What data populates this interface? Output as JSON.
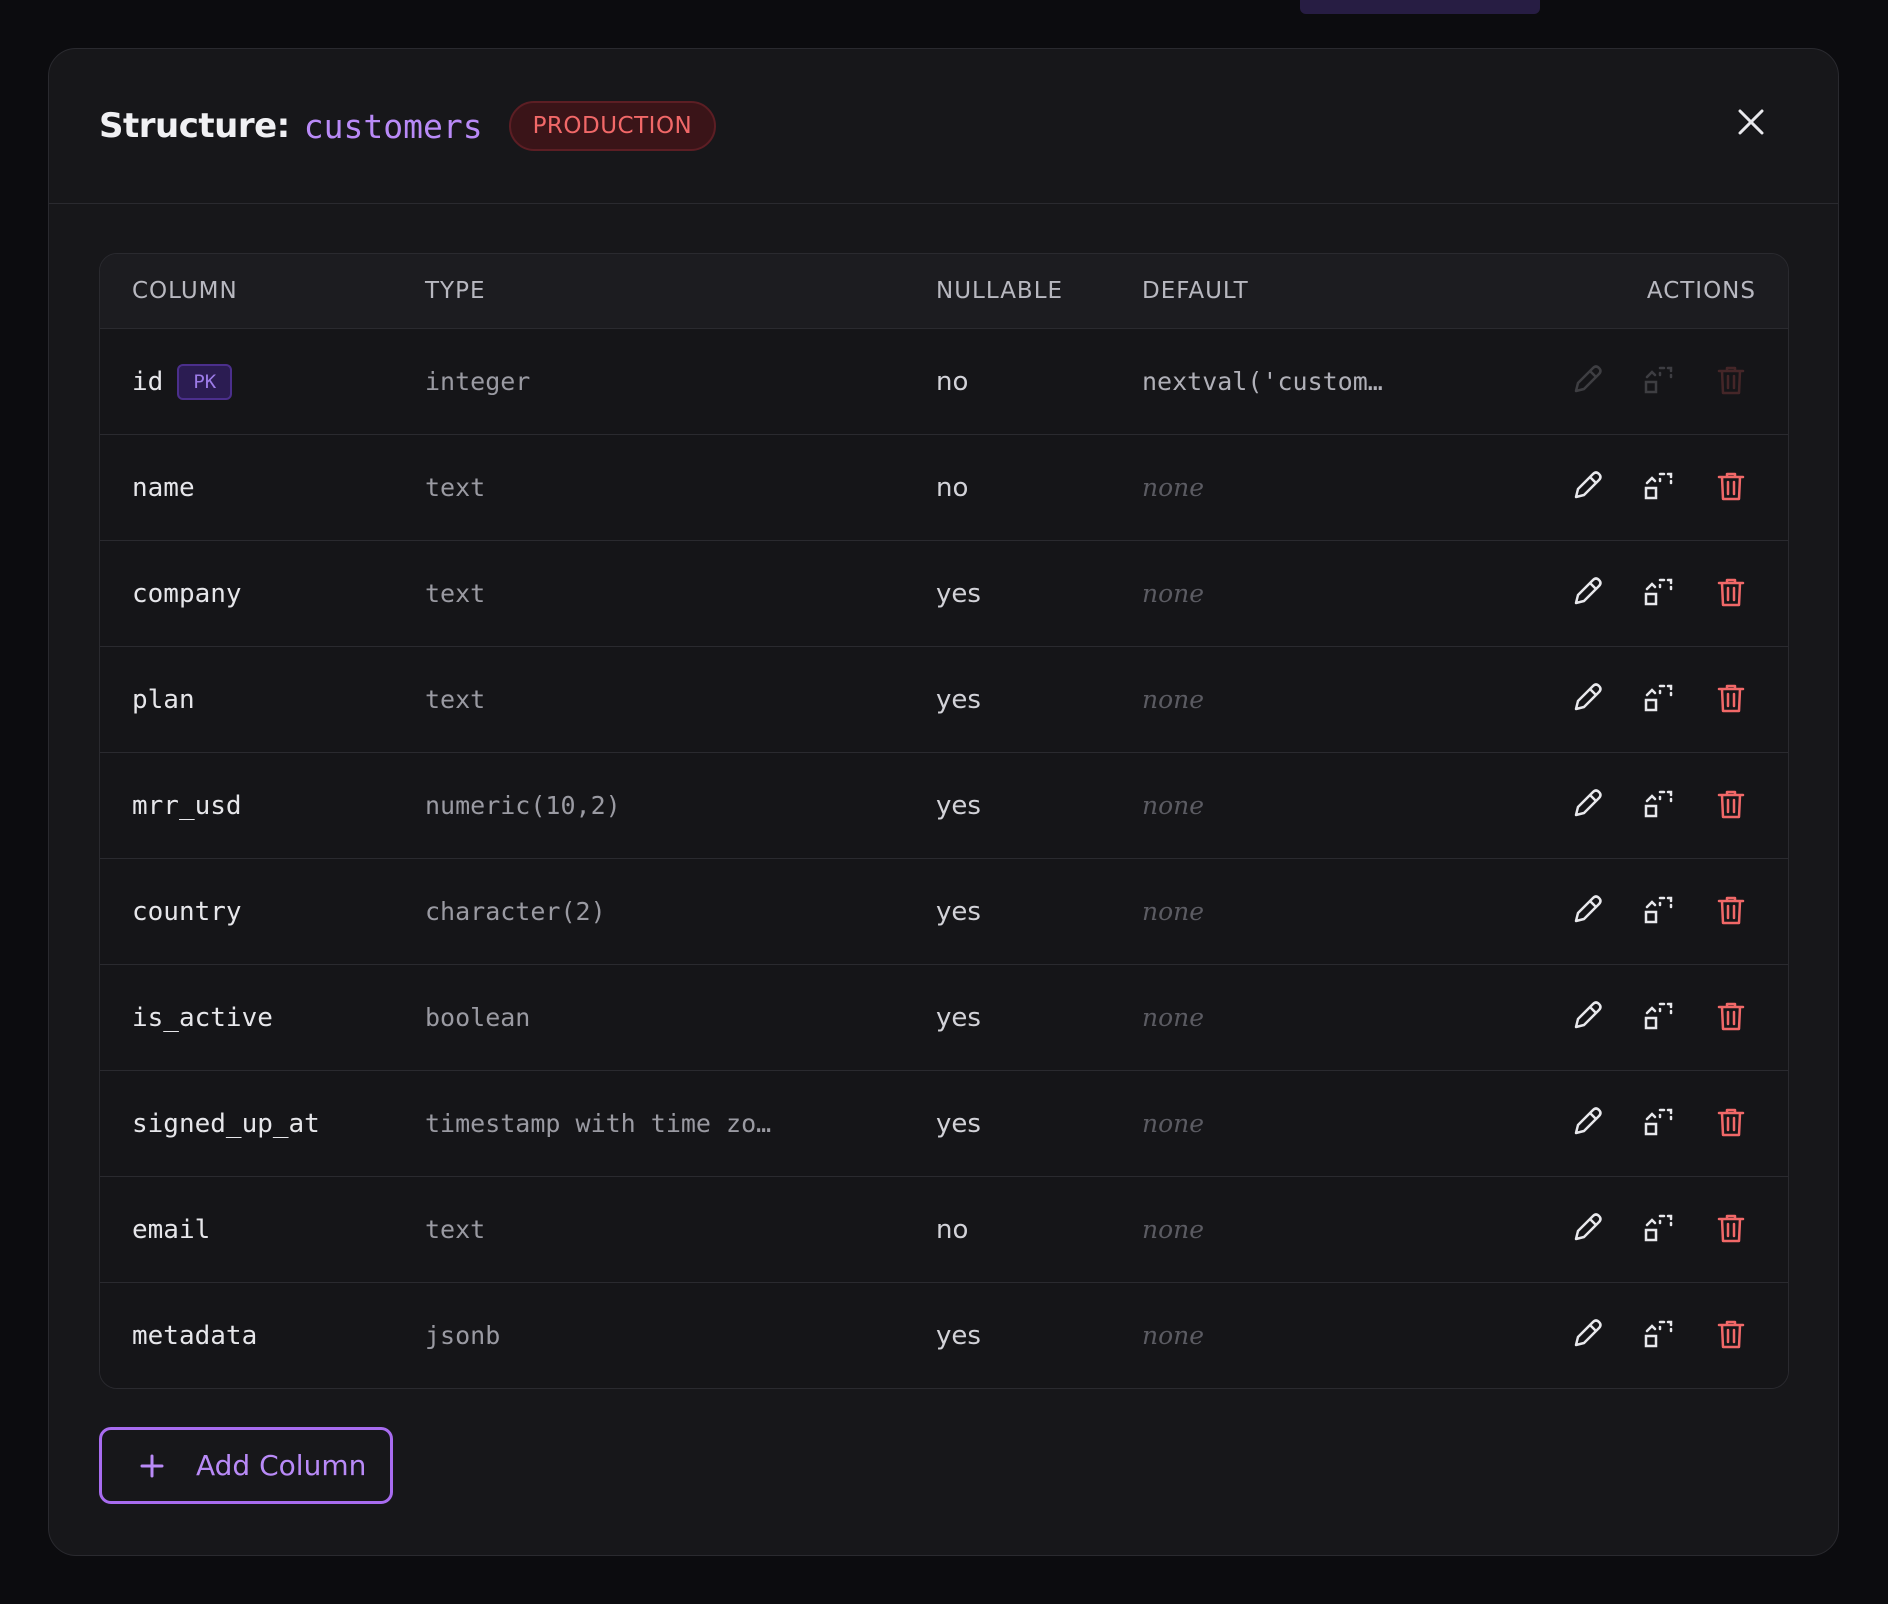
{
  "header": {
    "title_label": "Structure:",
    "table_name": "customers",
    "env_badge": "PRODUCTION"
  },
  "columns_header": {
    "column": "COLUMN",
    "type": "TYPE",
    "nullable": "NULLABLE",
    "default": "DEFAULT",
    "actions": "ACTIONS"
  },
  "rows": [
    {
      "name": "id",
      "pk": "PK",
      "type": "integer",
      "nullable": "no",
      "default": "nextval('custom…",
      "default_none": false,
      "actions_disabled": true
    },
    {
      "name": "name",
      "type": "text",
      "nullable": "no",
      "default": "none",
      "default_none": true,
      "actions_disabled": false
    },
    {
      "name": "company",
      "type": "text",
      "nullable": "yes",
      "default": "none",
      "default_none": true,
      "actions_disabled": false
    },
    {
      "name": "plan",
      "type": "text",
      "nullable": "yes",
      "default": "none",
      "default_none": true,
      "actions_disabled": false
    },
    {
      "name": "mrr_usd",
      "type": "numeric(10,2)",
      "nullable": "yes",
      "default": "none",
      "default_none": true,
      "actions_disabled": false
    },
    {
      "name": "country",
      "type": "character(2)",
      "nullable": "yes",
      "default": "none",
      "default_none": true,
      "actions_disabled": false
    },
    {
      "name": "is_active",
      "type": "boolean",
      "nullable": "yes",
      "default": "none",
      "default_none": true,
      "actions_disabled": false
    },
    {
      "name": "signed_up_at",
      "type": "timestamp with time zo…",
      "nullable": "yes",
      "default": "none",
      "default_none": true,
      "actions_disabled": false
    },
    {
      "name": "email",
      "type": "text",
      "nullable": "no",
      "default": "none",
      "default_none": true,
      "actions_disabled": false
    },
    {
      "name": "metadata",
      "type": "jsonb",
      "nullable": "yes",
      "default": "none",
      "default_none": true,
      "actions_disabled": false
    }
  ],
  "add_button": {
    "label": "Add Column"
  },
  "icons": {
    "close": "close-icon",
    "edit": "pencil-icon",
    "move": "move-icon",
    "delete": "trash-icon",
    "add": "plus-icon"
  },
  "colors": {
    "accent": "#b98af7",
    "danger": "#f16868",
    "production_bg": "#3a1418"
  }
}
